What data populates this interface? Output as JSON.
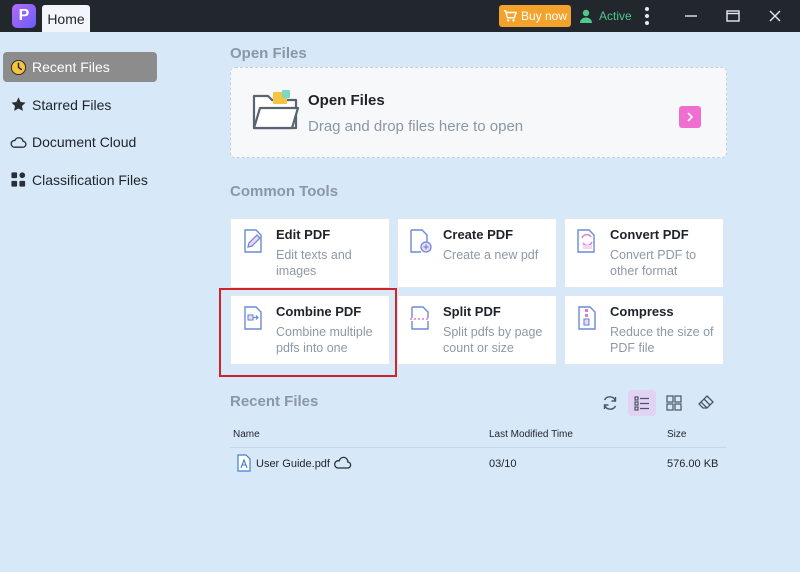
{
  "titlebar": {
    "logo_letter": "P",
    "tab_label": "Home",
    "buy_label": "Buy now",
    "status_label": "Active"
  },
  "sidebar": {
    "items": [
      {
        "label": "Recent Files",
        "icon": "clock-icon",
        "active": true
      },
      {
        "label": "Starred Files",
        "icon": "star-icon",
        "active": false
      },
      {
        "label": "Document Cloud",
        "icon": "cloud-icon",
        "active": false
      },
      {
        "label": "Classification Files",
        "icon": "grid-icon",
        "active": false
      }
    ]
  },
  "open_files": {
    "section_title": "Open Files",
    "title": "Open Files",
    "subtitle": "Drag and drop files here to open"
  },
  "common_tools": {
    "section_title": "Common Tools",
    "tools": [
      {
        "title": "Edit PDF",
        "desc": "Edit texts and images",
        "icon": "edit-pdf-icon"
      },
      {
        "title": "Create PDF",
        "desc": "Create a new pdf",
        "icon": "create-pdf-icon"
      },
      {
        "title": "Convert PDF",
        "desc": "Convert PDF to other format",
        "icon": "convert-pdf-icon"
      },
      {
        "title": "Combine PDF",
        "desc": "Combine multiple pdfs into one",
        "icon": "combine-pdf-icon"
      },
      {
        "title": "Split PDF",
        "desc": "Split pdfs by page count or size",
        "icon": "split-pdf-icon"
      },
      {
        "title": "Compress",
        "desc": "Reduce the size of PDF file",
        "icon": "compress-icon"
      }
    ]
  },
  "recent_files": {
    "section_title": "Recent Files",
    "columns": {
      "name": "Name",
      "modified": "Last Modified Time",
      "size": "Size"
    },
    "rows": [
      {
        "name": "User Guide.pdf",
        "modified": "03/10",
        "size": "576.00 KB"
      }
    ]
  },
  "colors": {
    "accent_buy": "#f3a32c",
    "status_active": "#4ec98a",
    "open_arrow": "#ef6fd0",
    "highlight": "#d2232a",
    "background": "#d7e9f8"
  }
}
